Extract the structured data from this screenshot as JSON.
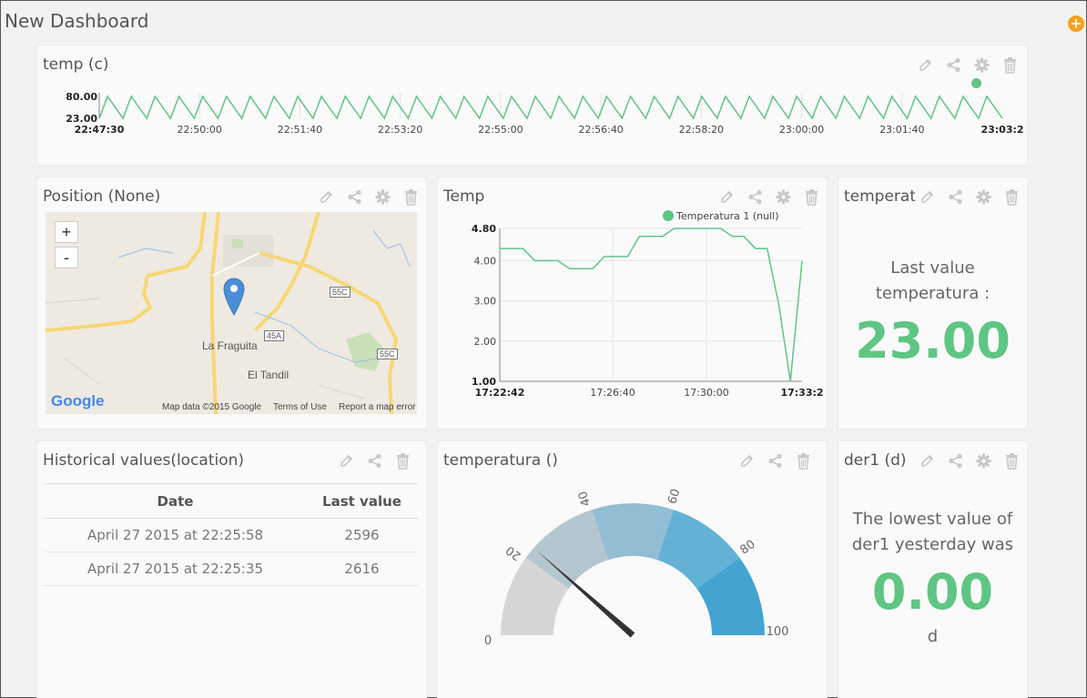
{
  "dashboard": {
    "title": "New Dashboard",
    "add_label": "+"
  },
  "colors": {
    "accent_green": "#5ec682",
    "add_orange": "#f7a11a"
  },
  "widgets": {
    "temp_line": {
      "title": "temp (c)"
    },
    "position": {
      "title": "Position (None)",
      "zoom_in": "+",
      "zoom_out": "-",
      "labels": {
        "town1": "La Fraguita",
        "town2": "El Tandil",
        "road1": "55C",
        "road2": "45A",
        "road3": "55C"
      },
      "footer": {
        "logo": "Google",
        "mapdata": "Map data ©2015 Google",
        "terms": "Terms of Use",
        "report": "Report a map error"
      }
    },
    "temp_chart": {
      "title": "Temp"
    },
    "temperat": {
      "title": "temperat",
      "caption_line1": "Last value",
      "caption_line2": "temperatura :",
      "value": "23.00"
    },
    "historical": {
      "title": "Historical values(location)",
      "columns": [
        "Date",
        "Last value"
      ],
      "rows": [
        {
          "date": "April 27 2015 at 22:25:58",
          "value": "2596"
        },
        {
          "date": "April 27 2015 at 22:25:35",
          "value": "2616"
        }
      ]
    },
    "gauge": {
      "title": "temperatura ()"
    },
    "der1": {
      "title": "der1 (d)",
      "caption_line1": "The lowest value of",
      "caption_line2": "der1 yesterday was",
      "value": "0.00",
      "unit": "d"
    }
  },
  "chart_data": [
    {
      "type": "line",
      "id": "temp_c",
      "ytick_labels": [
        "23.00",
        "80.00"
      ],
      "ylim": [
        23,
        80
      ],
      "xtick_labels": [
        "22:47:30",
        "22:50:00",
        "22:51:40",
        "22:53:20",
        "22:55:00",
        "22:56:40",
        "22:58:20",
        "23:00:00",
        "23:01:40",
        "23:03:2"
      ],
      "series": [
        {
          "color": "#5ec682",
          "pattern": "sawtooth",
          "cycles": 38,
          "min": 23,
          "max": 80
        }
      ]
    },
    {
      "type": "line",
      "id": "temp",
      "legend": "Temperatura 1 (null)",
      "legend_position": "top-right",
      "ytick_labels": [
        "1.00",
        "2.00",
        "3.00",
        "4.00",
        "4.80"
      ],
      "ylim": [
        1,
        4.8
      ],
      "xtick_labels": [
        "17:22:42",
        "17:26:40",
        "17:30:00",
        "17:33:2"
      ],
      "grid": true,
      "series": [
        {
          "name": "Temperatura 1 (null)",
          "color": "#5ec682",
          "values": [
            4.3,
            4.3,
            4.3,
            4.0,
            4.0,
            4.0,
            3.8,
            3.8,
            3.8,
            4.1,
            4.1,
            4.1,
            4.6,
            4.6,
            4.6,
            4.8,
            4.8,
            4.8,
            4.8,
            4.8,
            4.6,
            4.6,
            4.3,
            4.3,
            2.9,
            1.0,
            4.0
          ]
        }
      ]
    },
    {
      "type": "gauge",
      "id": "temperatura",
      "min": 0,
      "max": 100,
      "tick_labels": [
        "0",
        "20",
        "40",
        "60",
        "80",
        "100"
      ],
      "value": 23,
      "bands": [
        {
          "from": 0,
          "to": 20,
          "color": "#d6d6d6"
        },
        {
          "from": 20,
          "to": 40,
          "color": "#b4c6d0"
        },
        {
          "from": 40,
          "to": 60,
          "color": "#93bdd3"
        },
        {
          "from": 60,
          "to": 80,
          "color": "#63b2d6"
        },
        {
          "from": 80,
          "to": 100,
          "color": "#44a3d0"
        }
      ]
    }
  ]
}
